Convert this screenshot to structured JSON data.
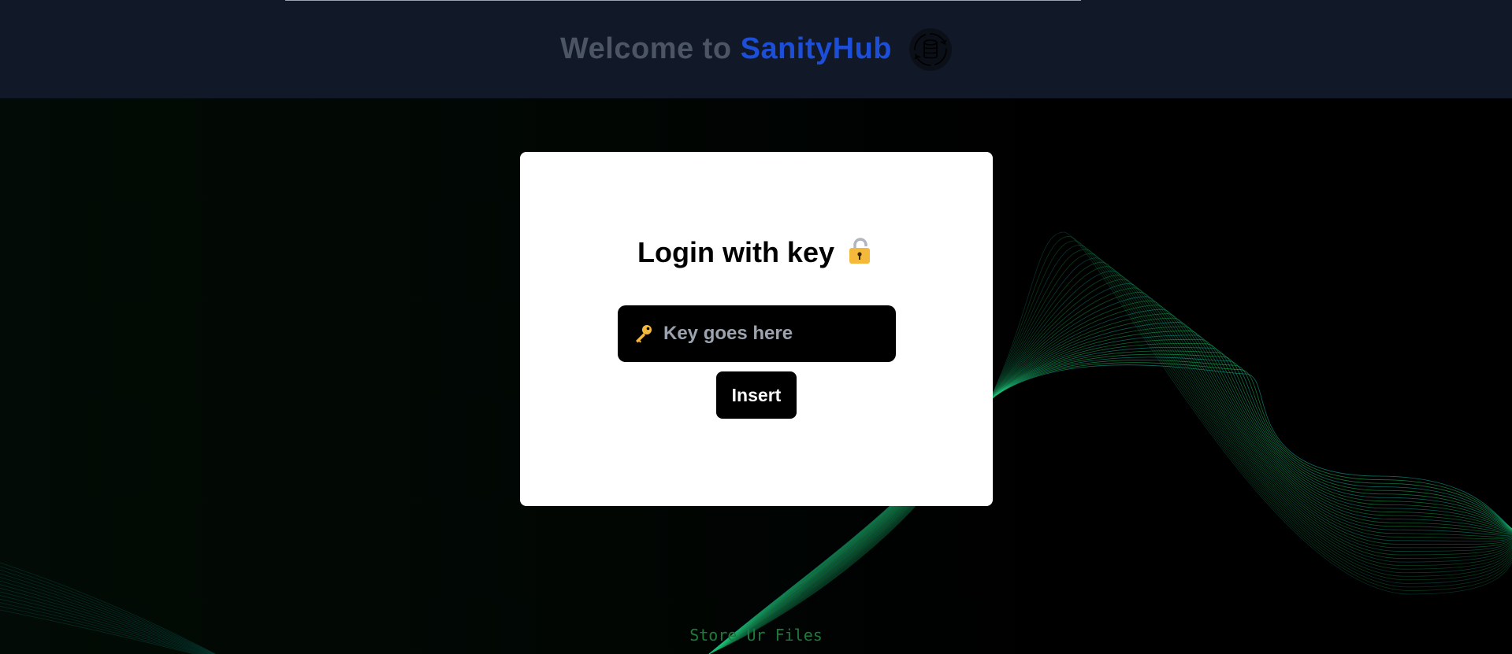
{
  "header": {
    "title_prefix": "Welcome to ",
    "title_brand": "SanityHub",
    "icon": "database-sync-icon"
  },
  "login_card": {
    "title": "Login with key",
    "title_icon": "lock-icon",
    "key_input": {
      "placeholder": "Key goes here",
      "value": "",
      "icon": "key-icon"
    },
    "insert_button_label": "Insert"
  },
  "footer": {
    "tagline": "Store Ur Files"
  },
  "colors": {
    "header_bg": "#111827",
    "brand": "#1d4ed8",
    "title_gray": "#4b5563",
    "wave_green": "#22c55e",
    "wave_teal": "#14b8a6"
  }
}
